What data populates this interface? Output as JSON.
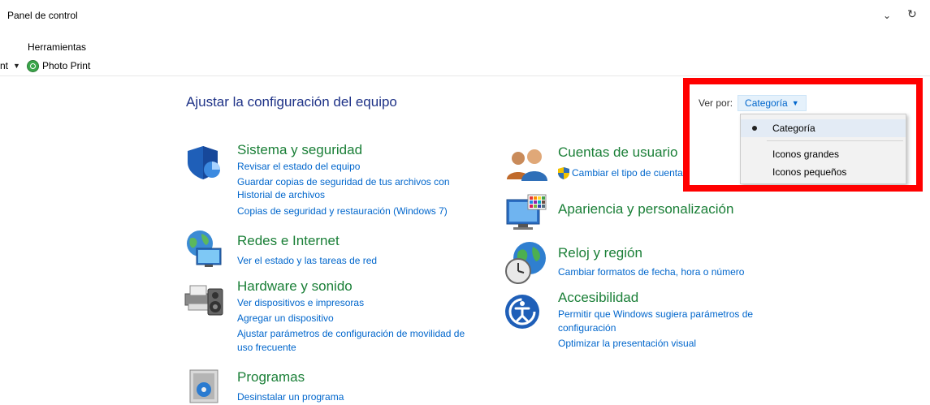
{
  "address_bar": {
    "title": "Panel de control"
  },
  "menu": {
    "tools": "Herramientas"
  },
  "toolbar": {
    "truncated_label": "nt",
    "photo_print": "Photo Print"
  },
  "heading": "Ajustar la configuración del equipo",
  "view_by": {
    "label": "Ver por:",
    "selected": "Categoría",
    "options": [
      "Categoría",
      "Iconos grandes",
      "Iconos pequeños"
    ]
  },
  "left_categories": [
    {
      "title": "Sistema y seguridad",
      "links": [
        "Revisar el estado del equipo",
        "Guardar copias de seguridad de tus archivos con",
        "Historial de archivos",
        "Copias de seguridad y restauración (Windows 7)"
      ]
    },
    {
      "title": "Redes e Internet",
      "links": [
        "Ver el estado y las tareas de red"
      ]
    },
    {
      "title": "Hardware y sonido",
      "links": [
        "Ver dispositivos e impresoras",
        "Agregar un dispositivo",
        "Ajustar parámetros de configuración de movilidad de",
        "uso frecuente"
      ]
    },
    {
      "title": "Programas",
      "links": [
        "Desinstalar un programa"
      ]
    }
  ],
  "right_categories": [
    {
      "title": "Cuentas de usuario",
      "links": [
        "Cambiar el tipo de cuenta"
      ]
    },
    {
      "title": "Apariencia y personalización",
      "links": []
    },
    {
      "title": "Reloj y región",
      "links": [
        "Cambiar formatos de fecha, hora o número"
      ]
    },
    {
      "title": "Accesibilidad",
      "links": [
        "Permitir que Windows sugiera parámetros de",
        "configuración",
        "Optimizar la presentación visual"
      ]
    }
  ],
  "colors": {
    "category_green": "#1a7f37",
    "link_blue": "#0066cc",
    "highlight_red": "#ff0000"
  }
}
